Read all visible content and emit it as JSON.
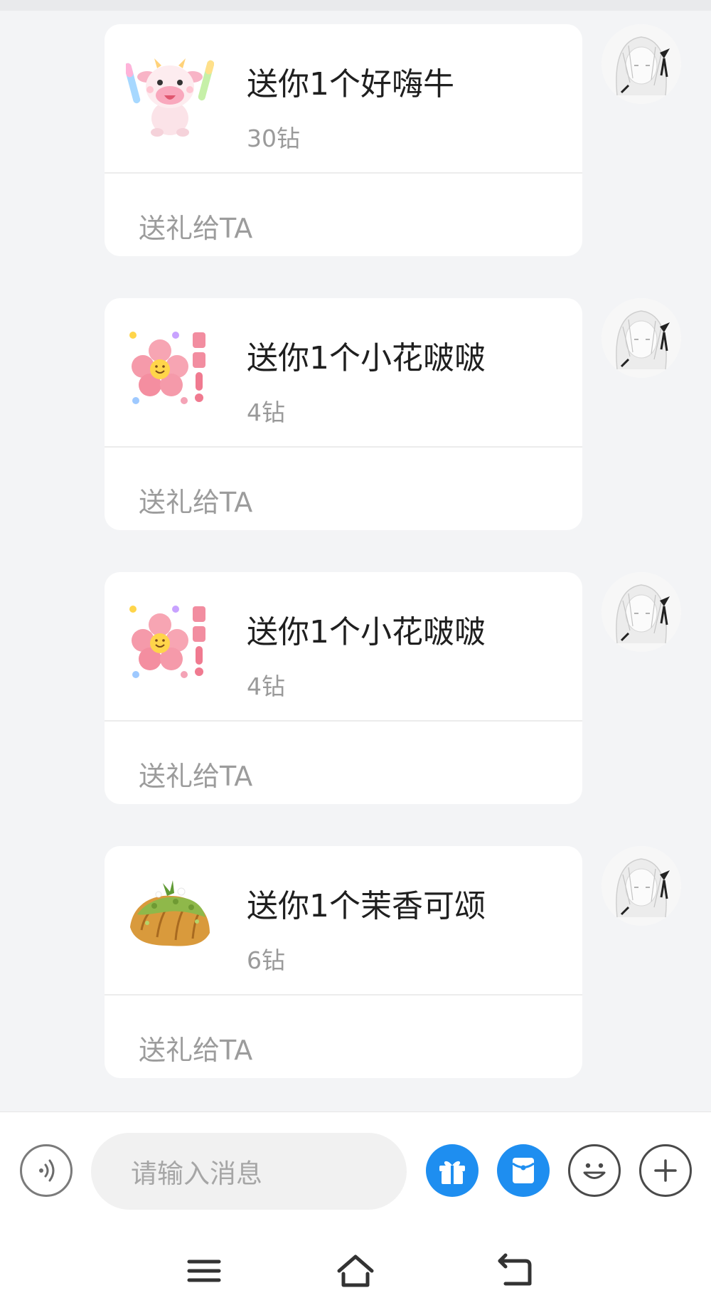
{
  "messages": [
    {
      "title": "送你1个好嗨牛",
      "price": "30钻",
      "action": "送礼给TA",
      "gift_icon": "cow-gift-icon"
    },
    {
      "title": "送你1个小花啵啵",
      "price": "4钻",
      "action": "送礼给TA",
      "gift_icon": "flower-gift-icon"
    },
    {
      "title": "送你1个小花啵啵",
      "price": "4钻",
      "action": "送礼给TA",
      "gift_icon": "flower-gift-icon"
    },
    {
      "title": "送你1个茉香可颂",
      "price": "6钻",
      "action": "送礼给TA",
      "gift_icon": "croissant-gift-icon"
    }
  ],
  "input": {
    "placeholder": "请输入消息"
  },
  "toolbar": {
    "icons": [
      "voice-icon",
      "gift-icon",
      "red-packet-icon",
      "emoji-icon",
      "plus-icon"
    ],
    "accent_color": "#1e8ef0"
  },
  "nav": {
    "icons": [
      "menu-icon",
      "home-icon",
      "back-icon"
    ]
  }
}
